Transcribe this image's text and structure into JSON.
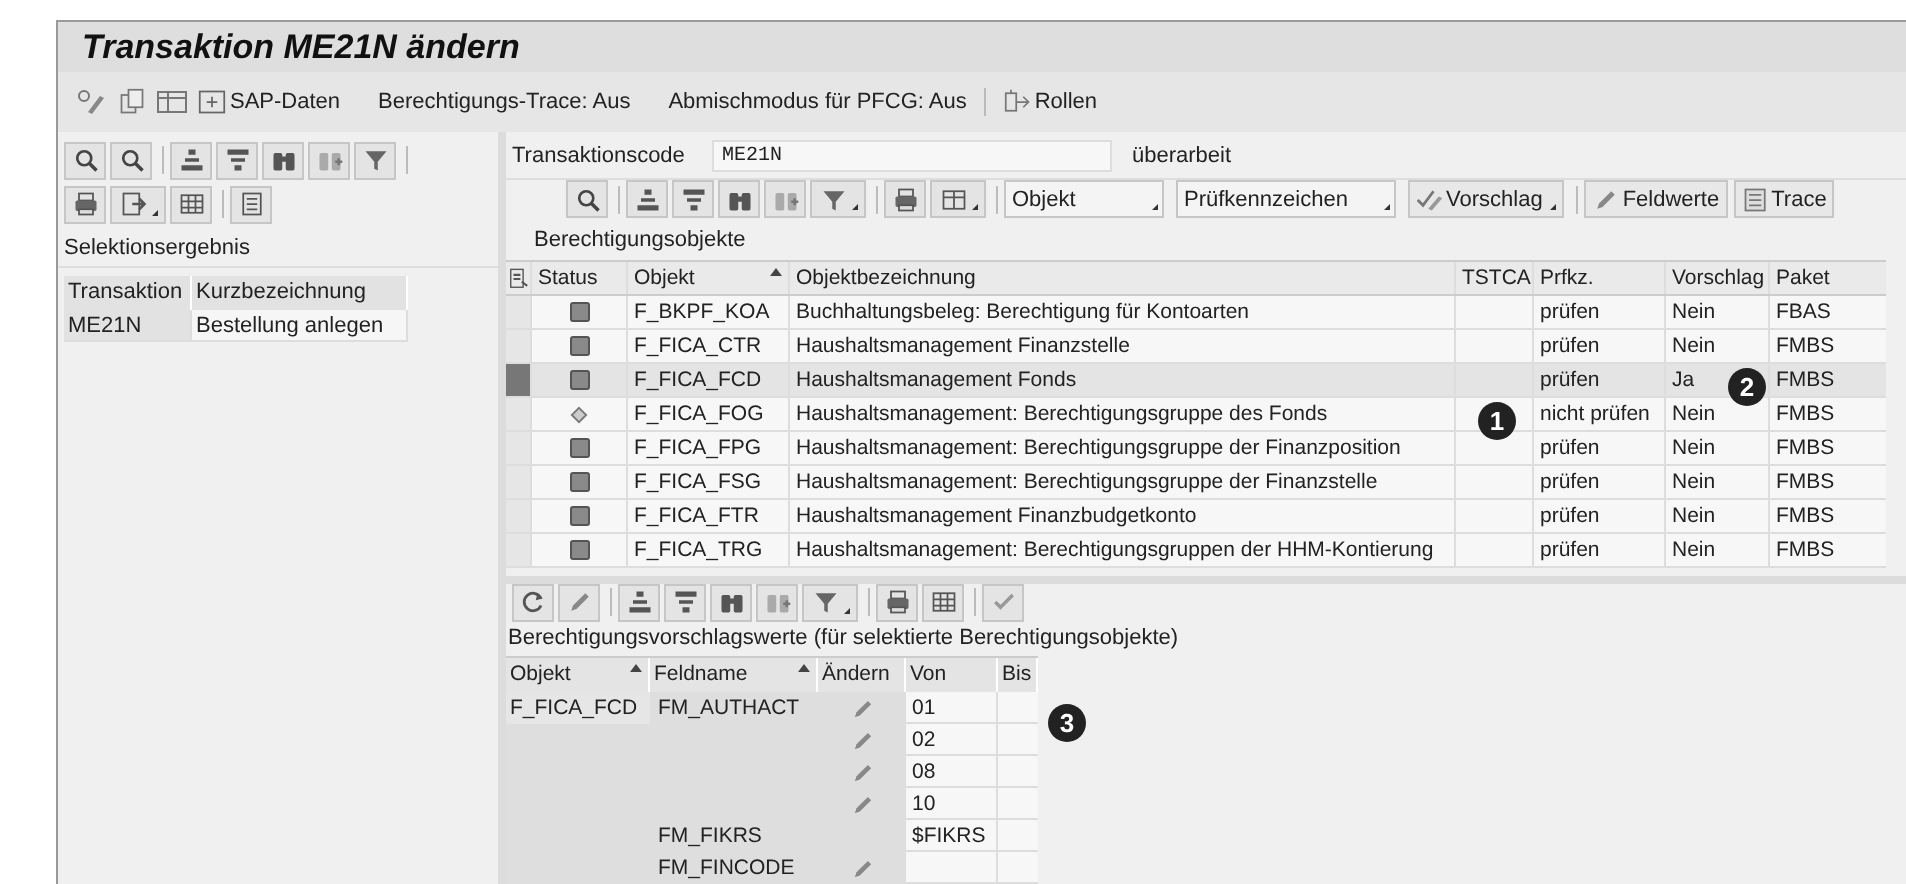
{
  "window": {
    "title": "Transaktion ME21N ändern"
  },
  "toolbar": {
    "sap_data": "SAP-Daten",
    "trace": "Berechtigungs-Trace: Aus",
    "mix_mode": "Abmischmodus für PFCG: Aus",
    "roles": "Rollen"
  },
  "left_panel": {
    "title": "Selektionsergebnis",
    "columns": [
      "Transaktion",
      "Kurzbezeichnung"
    ],
    "rows": [
      {
        "cells": [
          "ME21N",
          "Bestellung anlegen"
        ]
      }
    ]
  },
  "header": {
    "label": "Transaktionscode",
    "value": "ME21N",
    "status": "überarbeit"
  },
  "objects_toolbar": {
    "dropdowns": [
      "Objekt",
      "Prüfkennzeichen"
    ],
    "buttons": [
      "Vorschlag",
      "Feldwerte",
      "Trace"
    ]
  },
  "objects_table": {
    "title": "Berechtigungsobjekte",
    "columns": [
      "Status",
      "Objekt",
      "Objektbezeichnung",
      "TSTCA",
      "Prfkz.",
      "Vorschlag",
      "Paket"
    ],
    "rows": [
      {
        "kind": "square",
        "objekt": "F_BKPF_KOA",
        "bezeichnung": "Buchhaltungsbeleg: Berechtigung für Kontoarten",
        "prfkz": "prüfen",
        "vorschlag": "Nein",
        "paket": "FBAS",
        "selected": false
      },
      {
        "kind": "square",
        "objekt": "F_FICA_CTR",
        "bezeichnung": "Haushaltsmanagement Finanzstelle",
        "prfkz": "prüfen",
        "vorschlag": "Nein",
        "paket": "FMBS",
        "selected": false
      },
      {
        "kind": "square",
        "objekt": "F_FICA_FCD",
        "bezeichnung": "Haushaltsmanagement Fonds",
        "prfkz": "prüfen",
        "vorschlag": "Ja",
        "paket": "FMBS",
        "selected": true
      },
      {
        "kind": "diamond",
        "objekt": "F_FICA_FOG",
        "bezeichnung": "Haushaltsmanagement: Berechtigungsgruppe des Fonds",
        "prfkz": "nicht prüfen",
        "vorschlag": "Nein",
        "paket": "FMBS",
        "selected": false
      },
      {
        "kind": "square",
        "objekt": "F_FICA_FPG",
        "bezeichnung": "Haushaltsmanagement: Berechtigungsgruppe der Finanzposition",
        "prfkz": "prüfen",
        "vorschlag": "Nein",
        "paket": "FMBS",
        "selected": false
      },
      {
        "kind": "square",
        "objekt": "F_FICA_FSG",
        "bezeichnung": "Haushaltsmanagement: Berechtigungsgruppe der Finanzstelle",
        "prfkz": "prüfen",
        "vorschlag": "Nein",
        "paket": "FMBS",
        "selected": false
      },
      {
        "kind": "square",
        "objekt": "F_FICA_FTR",
        "bezeichnung": "Haushaltsmanagement Finanzbudgetkonto",
        "prfkz": "prüfen",
        "vorschlag": "Nein",
        "paket": "FMBS",
        "selected": false
      },
      {
        "kind": "square",
        "objekt": "F_FICA_TRG",
        "bezeichnung": "Haushaltsmanagement: Berechtigungsgruppen der HHM-Kontierung",
        "prfkz": "prüfen",
        "vorschlag": "Nein",
        "paket": "FMBS",
        "selected": false
      }
    ]
  },
  "values_table": {
    "title": "Berechtigungsvorschlagswerte (für selektierte Berechtigungsobjekte)",
    "columns": [
      "Objekt",
      "Feldname",
      "Ändern",
      "Von",
      "Bis"
    ],
    "rows": [
      {
        "objekt": "F_FICA_FCD",
        "feldname": "FM_AUTHACT",
        "editable": true,
        "von": "01"
      },
      {
        "editable": true,
        "von": "02"
      },
      {
        "editable": true,
        "von": "08"
      },
      {
        "editable": true,
        "von": "10"
      },
      {
        "feldname": "FM_FIKRS",
        "editable": false,
        "von": "$FIKRS"
      },
      {
        "feldname": "FM_FINCODE",
        "editable": true
      }
    ]
  },
  "callouts": [
    "1",
    "2",
    "3"
  ]
}
